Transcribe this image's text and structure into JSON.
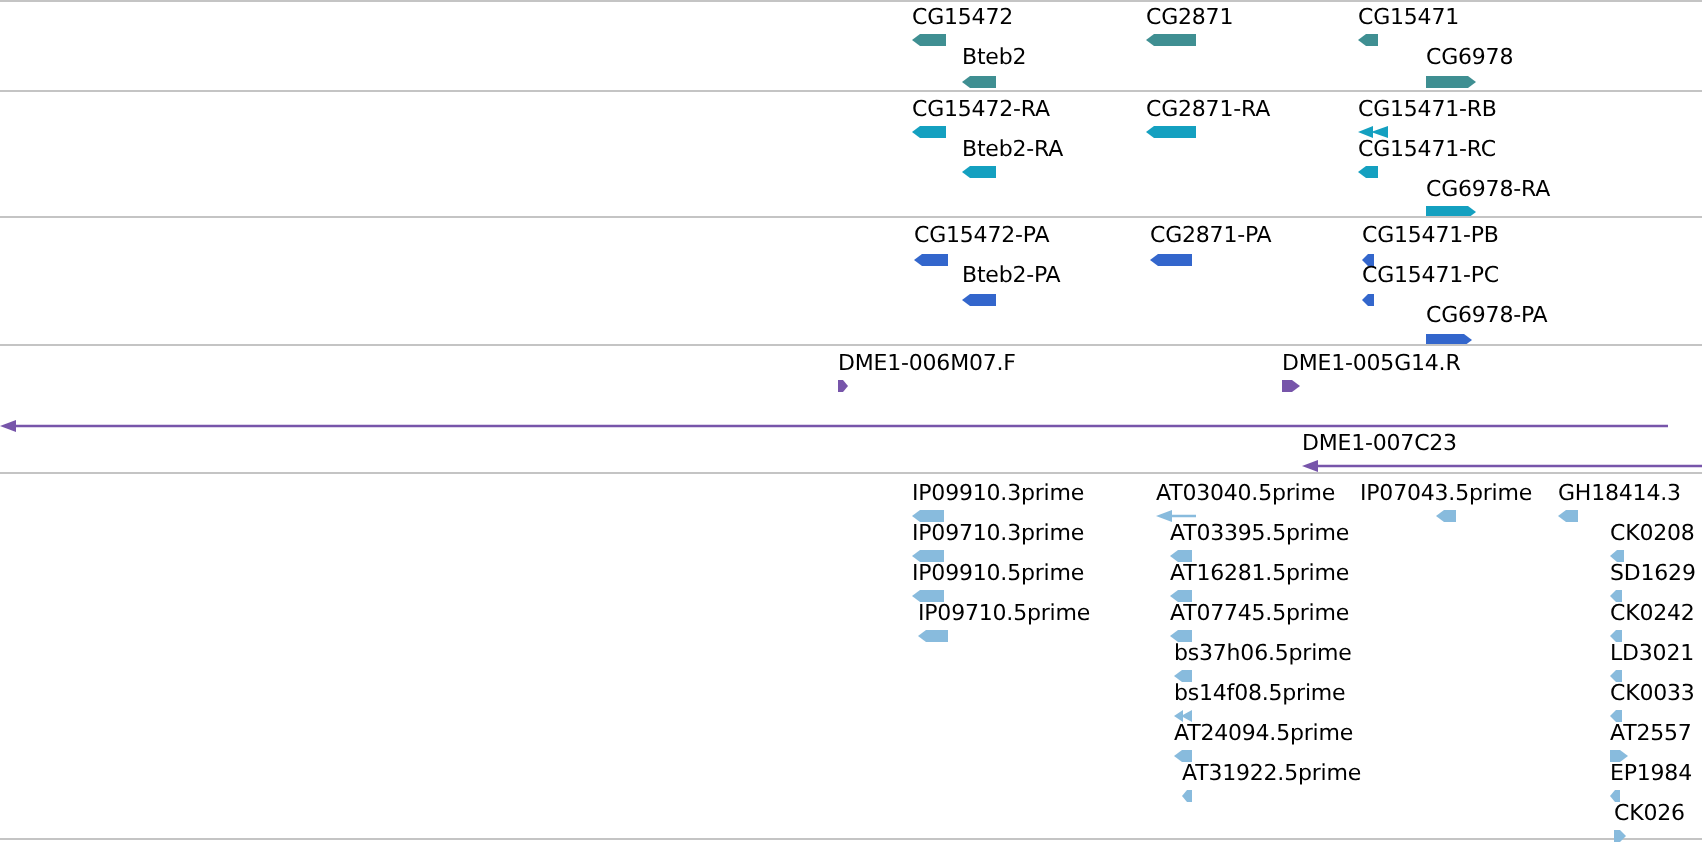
{
  "tracks": [
    {
      "color": "#3f8f92",
      "features": [
        {
          "label": "CG15472",
          "reverse": true,
          "kind": "block"
        },
        {
          "label": "Bteb2",
          "reverse": true,
          "kind": "block"
        },
        {
          "label": "CG2871",
          "reverse": true,
          "kind": "block"
        },
        {
          "label": "CG15471",
          "reverse": true,
          "kind": "block"
        },
        {
          "label": "CG6978",
          "reverse": false,
          "kind": "block"
        }
      ]
    },
    {
      "color": "#14a0c0",
      "features": [
        {
          "label": "CG15472-RA",
          "reverse": true,
          "kind": "block"
        },
        {
          "label": "Bteb2-RA",
          "reverse": true,
          "kind": "block"
        },
        {
          "label": "CG2871-RA",
          "reverse": true,
          "kind": "block"
        },
        {
          "label": "CG15471-RB",
          "reverse": true,
          "kind": "split"
        },
        {
          "label": "CG15471-RC",
          "reverse": true,
          "kind": "block"
        },
        {
          "label": "CG6978-RA",
          "reverse": false,
          "kind": "block"
        }
      ]
    },
    {
      "color": "#3366cc",
      "features": [
        {
          "label": "CG15472-PA",
          "reverse": true,
          "kind": "block"
        },
        {
          "label": "Bteb2-PA",
          "reverse": true,
          "kind": "block"
        },
        {
          "label": "CG2871-PA",
          "reverse": true,
          "kind": "block"
        },
        {
          "label": "CG15471-PB",
          "reverse": true,
          "kind": "block"
        },
        {
          "label": "CG15471-PC",
          "reverse": true,
          "kind": "block"
        },
        {
          "label": "CG6978-PA",
          "reverse": false,
          "kind": "block"
        }
      ]
    },
    {
      "color": "#7755aa",
      "features": [
        {
          "label": "DME1-006M07.F",
          "reverse": false,
          "kind": "block"
        },
        {
          "label": "DME1-005G14.R",
          "reverse": false,
          "kind": "block"
        },
        {
          "reverse": true,
          "kind": "line"
        },
        {
          "label": "DME1-007C23",
          "reverse": true,
          "kind": "line"
        }
      ]
    },
    {
      "color": "#88bbdd",
      "features": [
        {
          "label": "IP09910.3prime",
          "reverse": true,
          "kind": "block"
        },
        {
          "label": "IP09710.3prime",
          "reverse": true,
          "kind": "block"
        },
        {
          "label": "IP09910.5prime",
          "reverse": true,
          "kind": "block"
        },
        {
          "label": "IP09710.5prime",
          "reverse": true,
          "kind": "block"
        },
        {
          "label": "AT03040.5prime",
          "reverse": true,
          "kind": "line"
        },
        {
          "label": "AT03395.5prime",
          "reverse": true,
          "kind": "block"
        },
        {
          "label": "AT16281.5prime",
          "reverse": true,
          "kind": "block"
        },
        {
          "label": "AT07745.5prime",
          "reverse": true,
          "kind": "block"
        },
        {
          "label": "bs37h06.5prime",
          "reverse": true,
          "kind": "block"
        },
        {
          "label": "bs14f08.5prime",
          "reverse": true,
          "kind": "split"
        },
        {
          "label": "AT24094.5prime",
          "reverse": true,
          "kind": "block"
        },
        {
          "label": "AT31922.5prime",
          "reverse": true,
          "kind": "block"
        },
        {
          "label": "IP07043.5prime",
          "reverse": true,
          "kind": "block"
        },
        {
          "label": "GH18414.3",
          "reverse": true,
          "kind": "block"
        },
        {
          "label": "CK0208",
          "reverse": true,
          "kind": "block"
        },
        {
          "label": "SD1629",
          "reverse": true,
          "kind": "block"
        },
        {
          "label": "CK0242",
          "reverse": true,
          "kind": "block"
        },
        {
          "label": "LD3021",
          "reverse": true,
          "kind": "block"
        },
        {
          "label": "CK0033",
          "reverse": true,
          "kind": "block"
        },
        {
          "label": "AT2557",
          "reverse": false,
          "kind": "block"
        },
        {
          "label": "EP1984",
          "reverse": true,
          "kind": "block"
        },
        {
          "label": "CK026",
          "reverse": false,
          "kind": "block"
        }
      ]
    }
  ]
}
